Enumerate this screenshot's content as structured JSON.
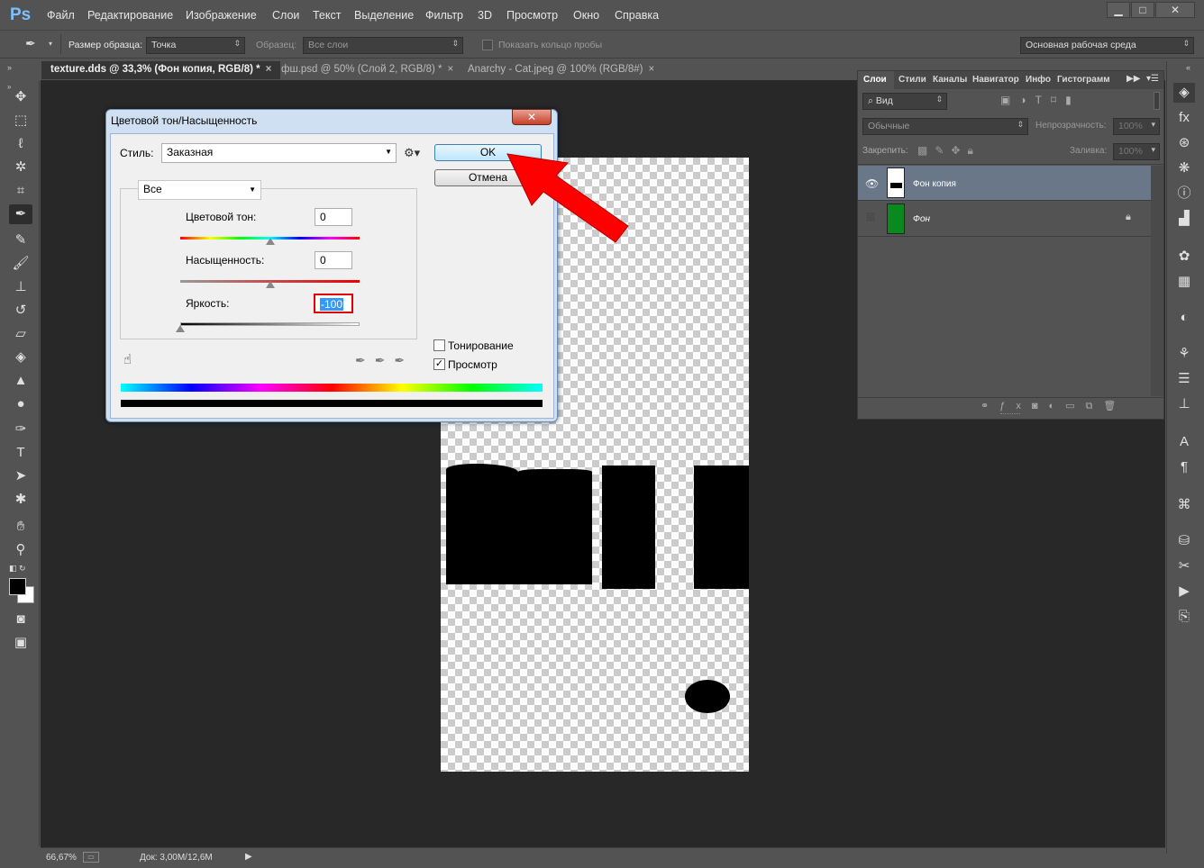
{
  "app": {
    "logo": "Ps"
  },
  "menu": [
    "Файл",
    "Редактирование",
    "Изображение",
    "Слои",
    "Текст",
    "Выделение",
    "Фильтр",
    "3D",
    "Просмотр",
    "Окно",
    "Справка"
  ],
  "window_controls": {
    "minimize": "▁",
    "maximize": "□",
    "close": "✕"
  },
  "options": {
    "sample_size_label": "Размер образца:",
    "sample_size_value": "Точка",
    "sample_label": "Образец:",
    "sample_value": "Все слои",
    "ring_label": "Показать кольцо пробы",
    "workspace_value": "Основная рабочая среда"
  },
  "tabs": [
    {
      "label": "texture.dds @ 33,3% (Фон копия, RGB/8) *",
      "close": "×"
    },
    {
      "label": "фш.psd @ 50% (Слой 2, RGB/8) *",
      "close": "×"
    },
    {
      "label": "Anarchy - Cat.jpeg @ 100% (RGB/8#)",
      "close": "×"
    }
  ],
  "status": {
    "zoom": "66,67%",
    "doc": "Док: 3,00M/12,6M"
  },
  "panel": {
    "tabs": [
      "Слои",
      "Стили",
      "Каналы",
      "Навигатор",
      "Инфо",
      "Гистограмм"
    ],
    "filter_label": "Вид",
    "blend_mode": "Обычные",
    "opacity_label": "Непрозрачность:",
    "opacity_value": "100%",
    "lock_label": "Закрепить:",
    "fill_label": "Заливка:",
    "fill_value": "100%",
    "layers": [
      {
        "name": "Фон копия",
        "selected": true
      },
      {
        "name": "Фон",
        "selected": false
      }
    ]
  },
  "dialog": {
    "title": "Цветовой тон/Насыщенность",
    "style_label": "Стиль:",
    "style_value": "Заказная",
    "ok": "OK",
    "cancel": "Отмена",
    "range": "Все",
    "hue_label": "Цветовой тон:",
    "hue_value": "0",
    "saturation_label": "Насыщенность:",
    "saturation_value": "0",
    "lightness_label": "Яркость:",
    "lightness_value": "-100",
    "colorize_label": "Тонирование",
    "colorize_checked": false,
    "preview_label": "Просмотр",
    "preview_checked": true,
    "hue_slider_fraction": 0.5,
    "saturation_slider_fraction": 0.5,
    "lightness_slider_fraction": 0.0
  },
  "colors": {
    "arrow": "#ff0000",
    "highlight": "#3399ff",
    "layer_thumb_green": "#0a8a1e"
  }
}
